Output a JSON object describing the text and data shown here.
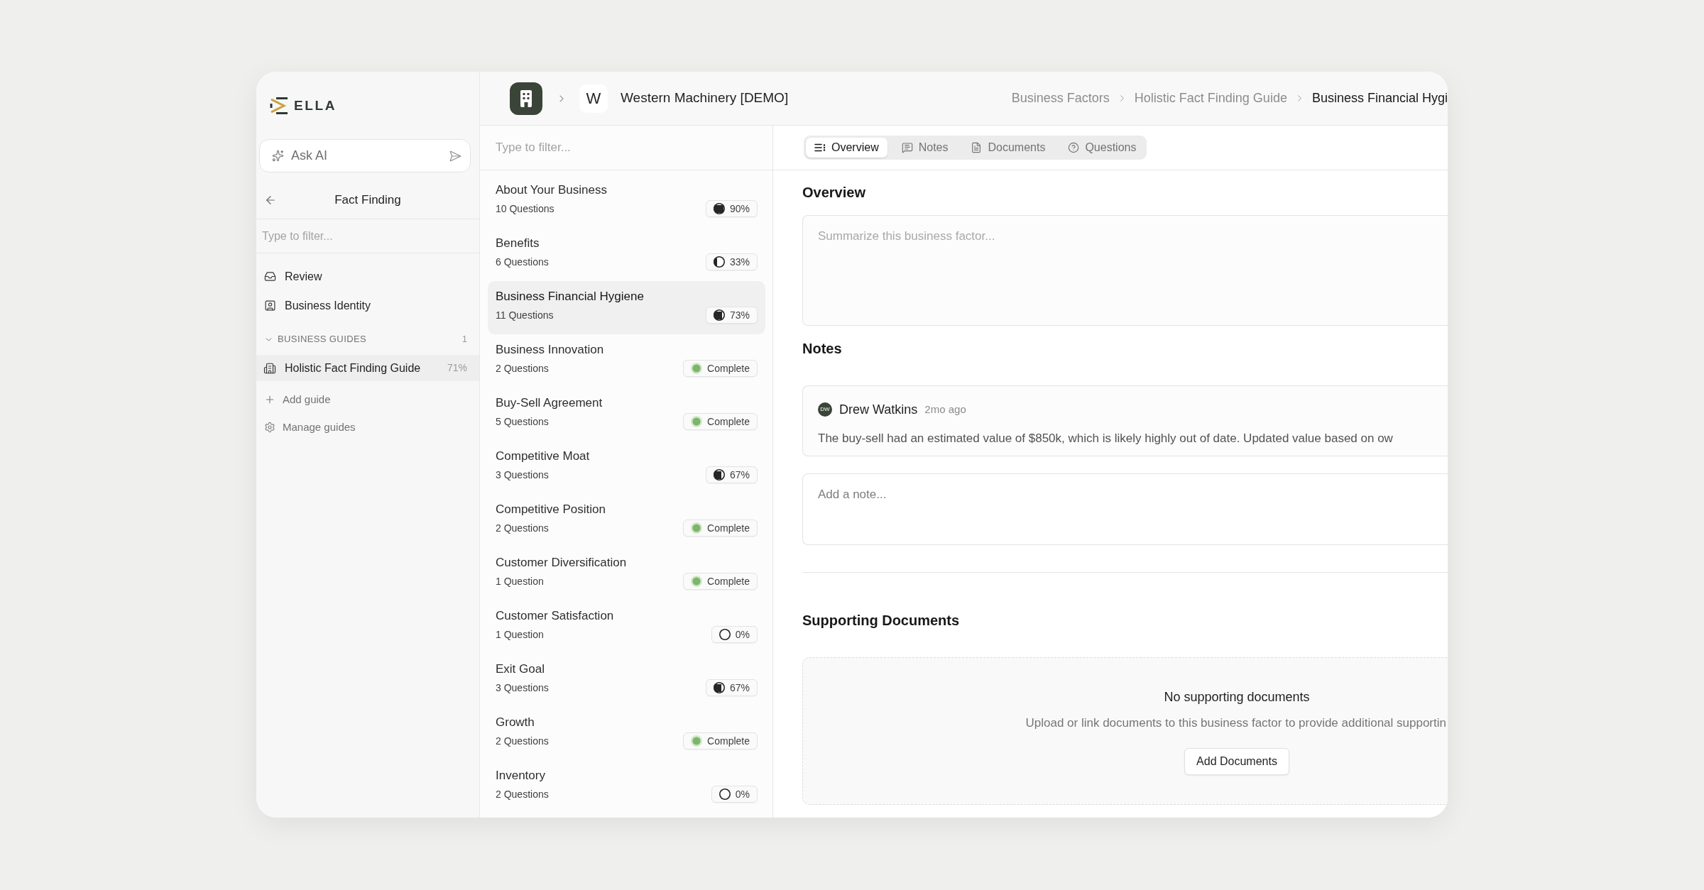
{
  "sidebar": {
    "logo": "ELLA",
    "ask_ai": {
      "placeholder": "Ask AI"
    },
    "title": "Fact Finding",
    "filter": {
      "placeholder": "Type to filter..."
    },
    "nav_items": [
      {
        "label": "Review",
        "kind": "review",
        "selected": false
      },
      {
        "label": "Business Identity",
        "kind": "identity",
        "selected": false
      }
    ],
    "guides": {
      "title": "BUSINESS GUIDES",
      "count": "1",
      "expanded": true,
      "items": [
        {
          "label": "Holistic Fact Finding Guide",
          "progress": "71%",
          "selected": true
        }
      ]
    },
    "actions": [
      {
        "label": "Add guide",
        "kind": "add"
      },
      {
        "label": "Manage guides",
        "kind": "manage"
      }
    ]
  },
  "header": {
    "company_initial": "W",
    "company_name": "Western Machinery [DEMO]",
    "breadcrumb": [
      {
        "label": "Business Factors",
        "current": false
      },
      {
        "label": "Holistic Fact Finding Guide",
        "current": false
      },
      {
        "label": "Business Financial Hygi",
        "current": true
      }
    ]
  },
  "factors": {
    "filter": {
      "placeholder": "Type to filter..."
    },
    "items": [
      {
        "title": "About Your Business",
        "questions": "10 Questions",
        "kind": "progress",
        "status": "90%",
        "level": 0.9,
        "selected": false
      },
      {
        "title": "Benefits",
        "questions": "6 Questions",
        "kind": "progress",
        "status": "33%",
        "level": 0.33,
        "selected": false
      },
      {
        "title": "Business Financial Hygiene",
        "questions": "11 Questions",
        "kind": "progress",
        "status": "73%",
        "level": 0.73,
        "selected": true
      },
      {
        "title": "Business Innovation",
        "questions": "2 Questions",
        "kind": "complete",
        "status": "Complete",
        "selected": false
      },
      {
        "title": "Buy-Sell Agreement",
        "questions": "5 Questions",
        "kind": "complete",
        "status": "Complete",
        "selected": false
      },
      {
        "title": "Competitive Moat",
        "questions": "3 Questions",
        "kind": "progress",
        "status": "67%",
        "level": 0.67,
        "selected": false
      },
      {
        "title": "Competitive Position",
        "questions": "2 Questions",
        "kind": "complete",
        "status": "Complete",
        "selected": false
      },
      {
        "title": "Customer Diversification",
        "questions": "1 Question",
        "kind": "complete",
        "status": "Complete",
        "selected": false
      },
      {
        "title": "Customer Satisfaction",
        "questions": "1 Question",
        "kind": "progress",
        "status": "0%",
        "selected": false
      },
      {
        "title": "Exit Goal",
        "questions": "3 Questions",
        "kind": "progress",
        "status": "67%",
        "level": 0.67,
        "selected": false
      },
      {
        "title": "Growth",
        "questions": "2 Questions",
        "kind": "complete",
        "status": "Complete",
        "selected": false
      },
      {
        "title": "Inventory",
        "questions": "2 Questions",
        "kind": "progress",
        "status": "0%",
        "selected": false
      }
    ]
  },
  "tabs": [
    {
      "label": "Overview",
      "kind": "overview",
      "selected": true
    },
    {
      "label": "Notes",
      "kind": "notes",
      "selected": false
    },
    {
      "label": "Documents",
      "kind": "documents",
      "selected": false
    },
    {
      "label": "Questions",
      "kind": "questions",
      "selected": false
    }
  ],
  "overview": {
    "title": "Overview",
    "summary": {
      "placeholder": "Summarize this business factor..."
    }
  },
  "notes": {
    "title": "Notes",
    "items": [
      {
        "initials": "DW",
        "author": "Drew Watkins",
        "time": "2mo ago",
        "text": "The buy-sell had an estimated value of $850k, which is likely highly out of date. Updated value based on ow"
      }
    ],
    "new_note": {
      "placeholder": "Add a note..."
    }
  },
  "documents": {
    "title": "Supporting Documents",
    "empty_title": "No supporting documents",
    "empty_text": "Upload or link documents to this business factor to provide additional supportin",
    "button": "Add Documents"
  }
}
